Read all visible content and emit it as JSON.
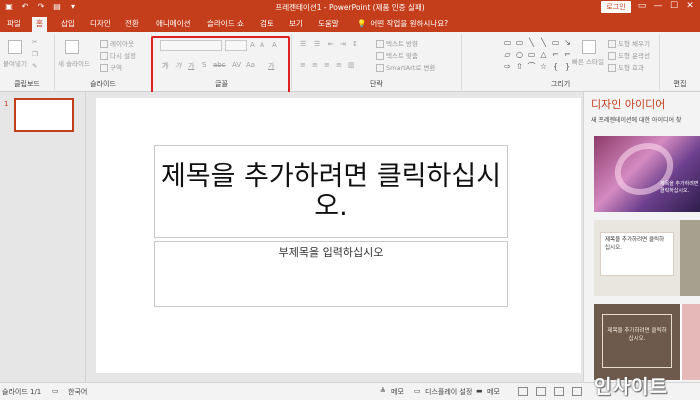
{
  "window": {
    "title": "프레젠테이션1 - PowerPoint (제품 인증 실패)",
    "login_label": "로그인",
    "controls": [
      "▭",
      "—",
      "☐",
      "✕"
    ]
  },
  "qat": [
    "▣",
    "↶",
    "↷",
    "▤",
    "▾"
  ],
  "tabs": [
    {
      "label": "파일"
    },
    {
      "label": "홈",
      "active": true
    },
    {
      "label": "삽입"
    },
    {
      "label": "디자인"
    },
    {
      "label": "전환"
    },
    {
      "label": "애니메이션"
    },
    {
      "label": "슬라이드 쇼"
    },
    {
      "label": "검토"
    },
    {
      "label": "보기"
    },
    {
      "label": "도움말"
    }
  ],
  "tell_me": "어떤 작업을 원하시나요?",
  "ribbon": {
    "groups": {
      "clipboard": "클립보드",
      "slides": "슬라이드",
      "font": "글꼴",
      "paragraph": "단락",
      "drawing": "그리기",
      "editing": "편집"
    },
    "clipboard": {
      "paste": "붙여넣기"
    },
    "slides": {
      "new_slide": "새 슬라이드",
      "layout": "레이아웃",
      "reset": "다시 설정",
      "section": "구역"
    },
    "font": {
      "bold": "가",
      "italic": "가",
      "underline": "가",
      "shadow": "S",
      "strike": "abc",
      "spacing": "AV",
      "case": "Aa",
      "color": "가",
      "grow": "A",
      "shrink": "A",
      "clear": "A"
    },
    "paragraph": {
      "direction": "텍스트 방향",
      "align": "텍스트 맞춤",
      "smartart": "SmartArt로 변환"
    },
    "drawing": {
      "quick_styles": "빠른 스타일",
      "fill": "도형 채우기",
      "outline": "도형 윤곽선",
      "effects": "도형 효과"
    },
    "shapes": [
      "▭",
      "▭",
      "╲",
      "╲",
      "▭",
      "↘",
      "▱",
      "○",
      "▭",
      "△",
      "⌐",
      "⌐",
      "⇨",
      "⇧",
      "⌒",
      "☆",
      "{",
      "}"
    ]
  },
  "thumbnail": {
    "number": "1"
  },
  "slide": {
    "title_placeholder": "제목을 추가하려면 클릭하십시오.",
    "subtitle_placeholder": "부제목을 입력하십시오"
  },
  "design_ideas": {
    "title": "디자인 아이디어",
    "subtitle": "새 프레젠테이션에 대한 아이디어 찾",
    "card1_label": "제목을 추가하려면 클릭하십시오.",
    "card2_label": "제목을 추가하려면 클릭하십시오.",
    "card3_label": "제목을 추가하려면 클릭하십시오."
  },
  "status": {
    "slide_info": "슬라이드 1/1",
    "language": "한국어",
    "notes": "메모",
    "display_settings": "디스플레이 설정",
    "comments": "메모"
  },
  "watermark": "인사이트",
  "colors": {
    "accent": "#c43e1c",
    "highlight": "#e02020"
  }
}
